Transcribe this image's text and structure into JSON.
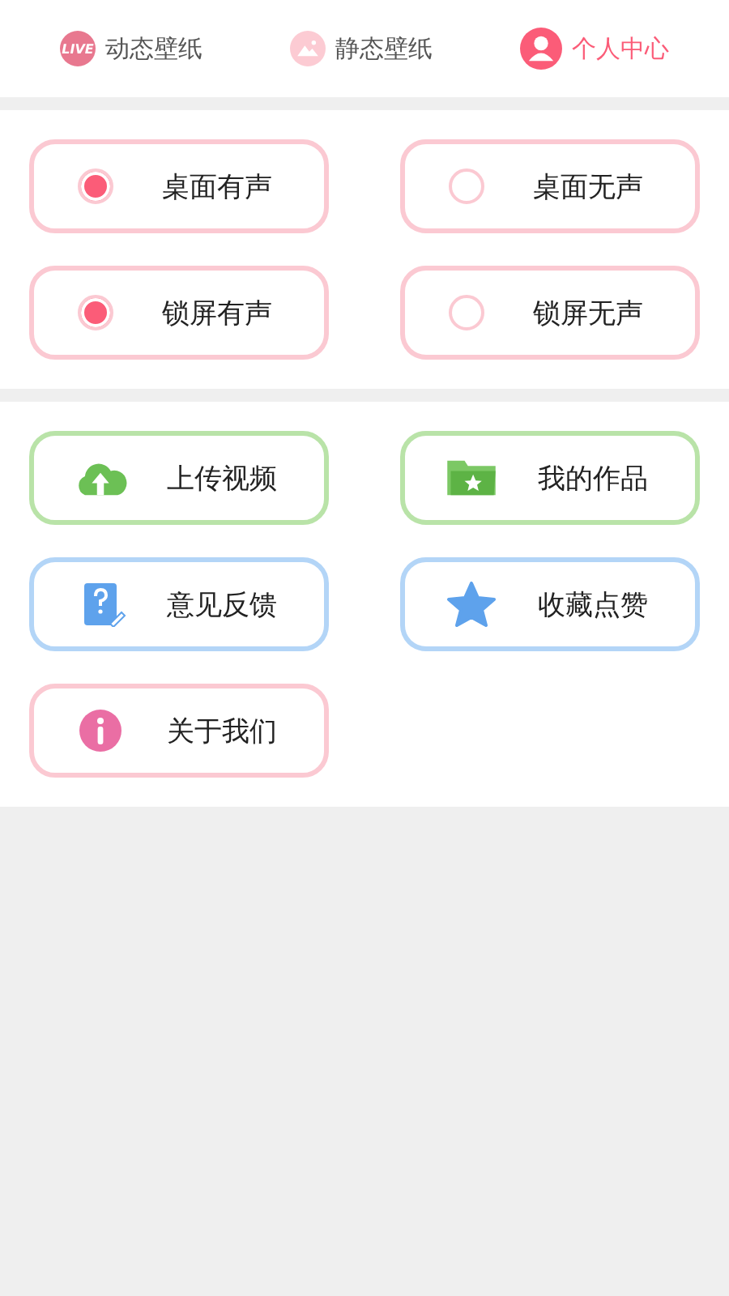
{
  "tabs": [
    {
      "label": "动态壁纸",
      "kind": "live",
      "icon_text": "LIVE",
      "selected": false
    },
    {
      "label": "静态壁纸",
      "kind": "image",
      "selected": false
    },
    {
      "label": "个人中心",
      "kind": "person",
      "selected": true
    }
  ],
  "sound_options": [
    {
      "label": "桌面有声",
      "selected": true
    },
    {
      "label": "桌面无声",
      "selected": false
    },
    {
      "label": "锁屏有声",
      "selected": true
    },
    {
      "label": "锁屏无声",
      "selected": false
    }
  ],
  "menu": [
    {
      "label": "上传视频",
      "kind": "upload",
      "color": "#b9e3a8"
    },
    {
      "label": "我的作品",
      "kind": "works",
      "color": "#b9e3a8"
    },
    {
      "label": "意见反馈",
      "kind": "feedback",
      "color": "#b3d5f7"
    },
    {
      "label": "收藏点赞",
      "kind": "favorite",
      "color": "#b3d5f7"
    },
    {
      "label": "关于我们",
      "kind": "about",
      "color": "#fbc9d2"
    }
  ]
}
